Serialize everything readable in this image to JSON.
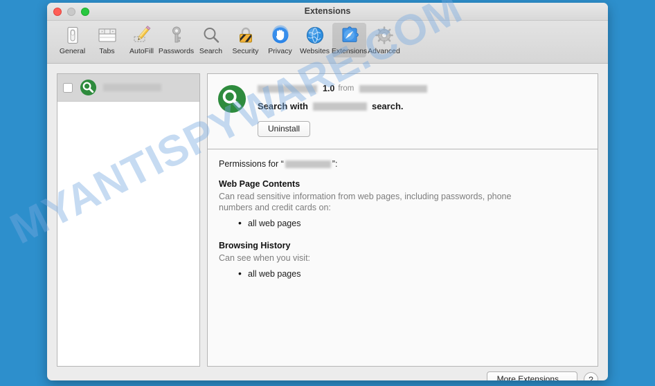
{
  "window": {
    "title": "Extensions",
    "traffic_lights": [
      {
        "name": "close",
        "color": "#ff5f57"
      },
      {
        "name": "minimize",
        "color": "#c9c9c9"
      },
      {
        "name": "zoom",
        "color": "#28c840"
      }
    ]
  },
  "toolbar": {
    "items": [
      {
        "label": "General",
        "icon": "general-icon",
        "selected": false
      },
      {
        "label": "Tabs",
        "icon": "tabs-icon",
        "selected": false
      },
      {
        "label": "AutoFill",
        "icon": "autofill-icon",
        "selected": false
      },
      {
        "label": "Passwords",
        "icon": "passwords-icon",
        "selected": false
      },
      {
        "label": "Search",
        "icon": "search-icon",
        "selected": false
      },
      {
        "label": "Security",
        "icon": "security-icon",
        "selected": false
      },
      {
        "label": "Privacy",
        "icon": "privacy-icon",
        "selected": false
      },
      {
        "label": "Websites",
        "icon": "websites-icon",
        "selected": false
      },
      {
        "label": "Extensions",
        "icon": "extensions-icon",
        "selected": true
      },
      {
        "label": "Advanced",
        "icon": "advanced-icon",
        "selected": false
      }
    ]
  },
  "extension_list": {
    "items": [
      {
        "name_redacted": true,
        "checked": false,
        "icon": "green-magnifier-icon",
        "selected": true
      }
    ]
  },
  "detail": {
    "icon": "green-magnifier-icon",
    "name_redacted": true,
    "version": "1.0",
    "from_label": "from",
    "developer_redacted": true,
    "description_prefix": "Search with",
    "description_suffix": "search.",
    "uninstall_label": "Uninstall"
  },
  "permissions": {
    "heading_prefix": "Permissions for “",
    "heading_suffix": "”:",
    "name_redacted": true,
    "blocks": [
      {
        "title": "Web Page Contents",
        "body": "Can read sensitive information from web pages, including passwords, phone numbers and credit cards on:",
        "items": [
          "all web pages"
        ]
      },
      {
        "title": "Browsing History",
        "body": "Can see when you visit:",
        "items": [
          "all web pages"
        ]
      }
    ]
  },
  "footer": {
    "more_extensions_label": "More Extensions…",
    "help_label": "?"
  },
  "watermark": {
    "text": "MYANTISPYWARE.COM"
  },
  "colors": {
    "desktop_background": "#2d8fcc",
    "extension_icon_green": "#2e8b3d",
    "selection_gray": "#d6d6d6",
    "watermark": "#78aae1"
  }
}
